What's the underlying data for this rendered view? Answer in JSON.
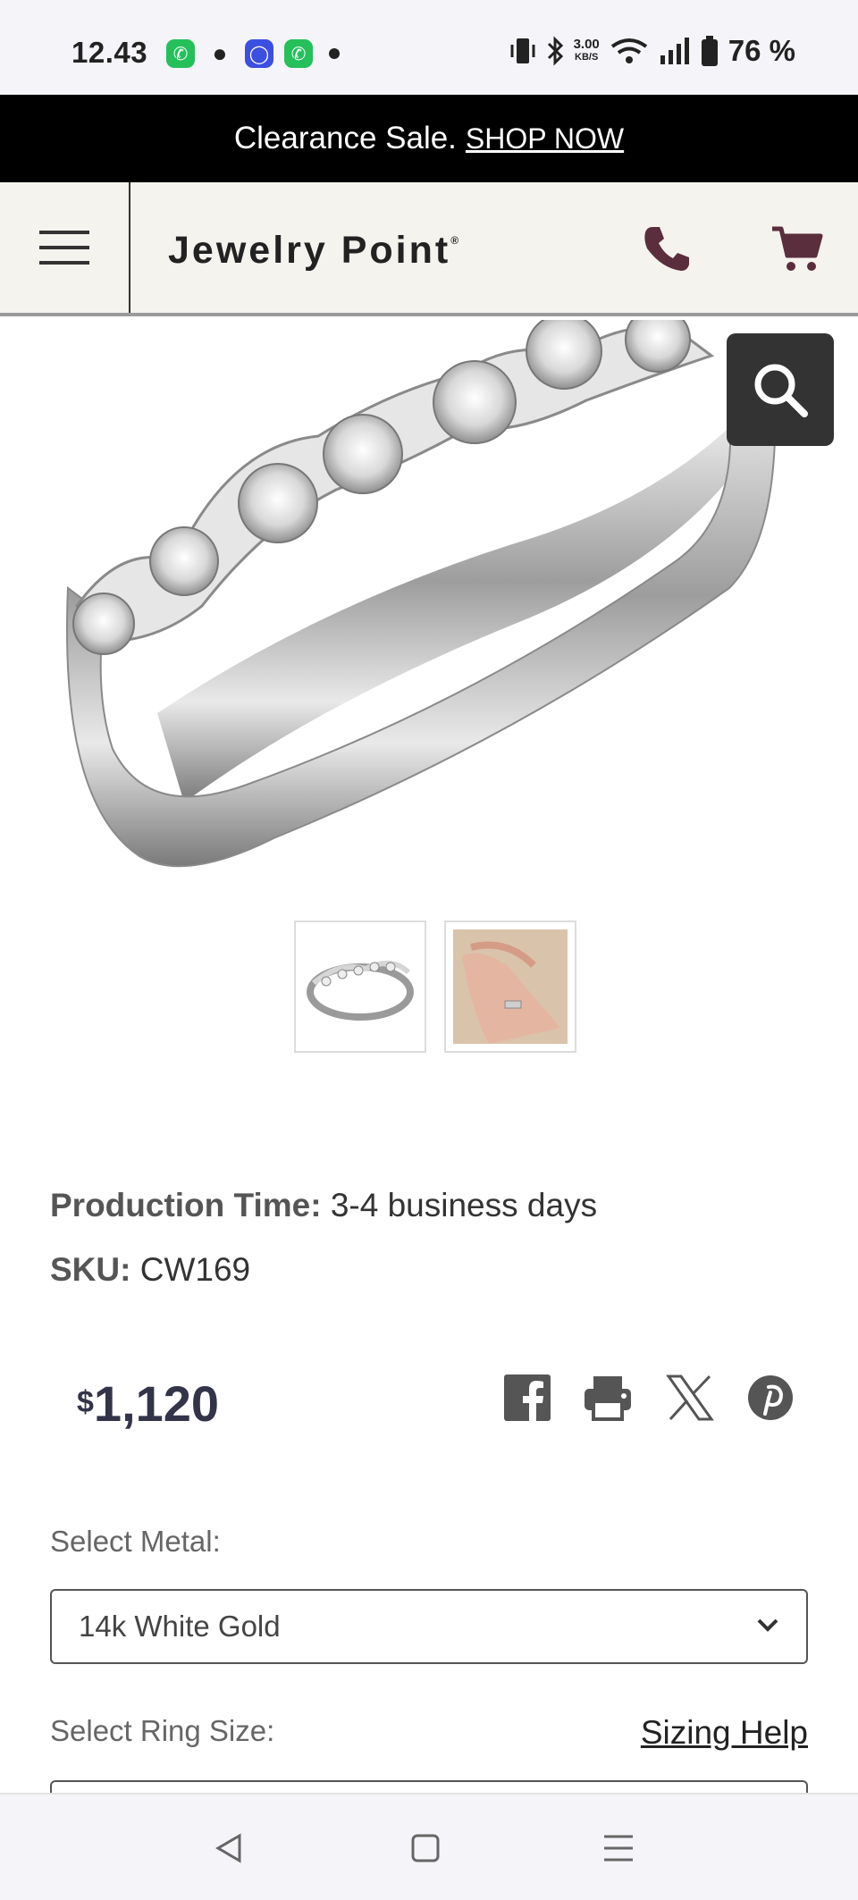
{
  "status_bar": {
    "time": "12.43",
    "speed_value": "3.00",
    "speed_unit": "KB/S",
    "battery": "76 %"
  },
  "promo": {
    "text": "Clearance Sale.",
    "link": "SHOP NOW"
  },
  "header": {
    "brand": "Jewelry Point",
    "brand_mark": "®"
  },
  "product": {
    "production_label": "Production Time:",
    "production_value": "3-4 business days",
    "sku_label": "SKU:",
    "sku_value": "CW169",
    "currency": "$",
    "price": "1,120"
  },
  "options": {
    "metal_label": "Select Metal:",
    "metal_value": "14k White Gold",
    "size_label": "Select Ring Size:",
    "sizing_help": "Sizing Help"
  },
  "colors": {
    "icon_accent": "#5a2e3d",
    "promo_bg": "#000000",
    "header_bg": "#f5f3ee"
  }
}
